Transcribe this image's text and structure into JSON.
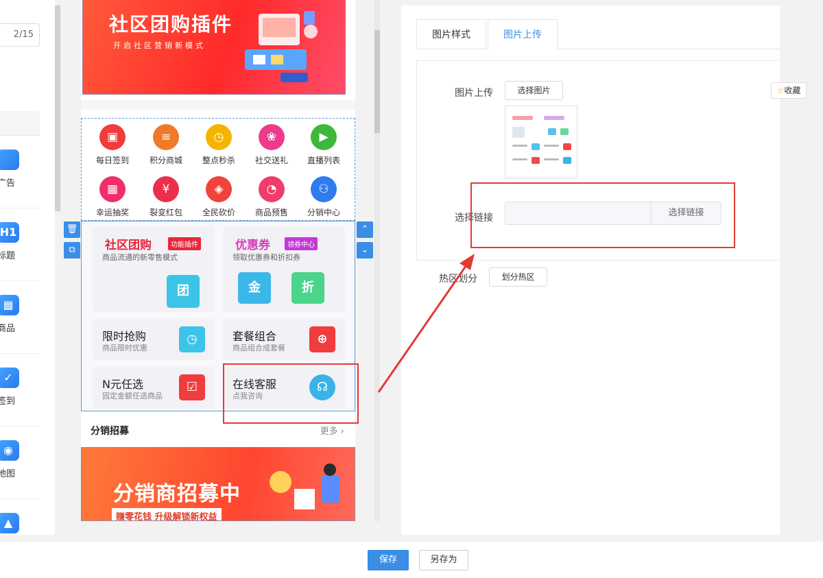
{
  "left_panel": {
    "counter": "2/15",
    "components": [
      {
        "label": "播广告",
        "icon": "ad-banner-icon",
        "glyph": ""
      },
      {
        "label": "标题",
        "icon": "heading-icon",
        "glyph": "H1"
      },
      {
        "label": "商品",
        "icon": "basket-icon",
        "glyph": "▦"
      },
      {
        "label": "签到",
        "icon": "calendar-check-icon",
        "glyph": "✓"
      },
      {
        "label": "地图",
        "icon": "map-pin-icon",
        "glyph": "◉"
      },
      {
        "label": "",
        "icon": "image-icon",
        "glyph": "▲"
      }
    ]
  },
  "preview": {
    "banner": {
      "title": "社区团购插件",
      "subtitle": "开启社区营销新模式"
    },
    "nav": [
      {
        "label": "每日签到",
        "icon": "calendar-icon",
        "glyph": "▣",
        "color": "#f03c3c"
      },
      {
        "label": "积分商城",
        "icon": "coins-icon",
        "glyph": "≡",
        "color": "#f07a2a"
      },
      {
        "label": "整点秒杀",
        "icon": "alarm-clock-icon",
        "glyph": "◷",
        "color": "#f5b400"
      },
      {
        "label": "社交送礼",
        "icon": "gift-icon",
        "glyph": "❀",
        "color": "#ee3a8c"
      },
      {
        "label": "直播列表",
        "icon": "live-tv-icon",
        "glyph": "▶",
        "color": "#3fb73b"
      },
      {
        "label": "幸运抽奖",
        "icon": "grid-icon",
        "glyph": "▦",
        "color": "#ef2f6a"
      },
      {
        "label": "裂变红包",
        "icon": "red-packet-icon",
        "glyph": "¥",
        "color": "#ea2f4d"
      },
      {
        "label": "全民砍价",
        "icon": "tag-icon",
        "glyph": "◈",
        "color": "#f0443a"
      },
      {
        "label": "商品预售",
        "icon": "presale-icon",
        "glyph": "◔",
        "color": "#ef3d6a"
      },
      {
        "label": "分销中心",
        "icon": "network-icon",
        "glyph": "⚇",
        "color": "#2f7bf0"
      }
    ],
    "cards": {
      "group_buy": {
        "title": "社区团购",
        "tag": "功能插件",
        "sub": "商品流通的新零售模式",
        "glyph": "团"
      },
      "coupon": {
        "title": "优惠券",
        "tag": "领券中心",
        "sub": "领取优惠券和折扣券",
        "glyph1": "金",
        "glyph2": "折"
      },
      "flash": {
        "title": "限时抢购",
        "sub": "商品限时优惠"
      },
      "combo": {
        "title": "套餐组合",
        "sub": "商品组合成套餐"
      },
      "nyuan": {
        "title": "N元任选",
        "sub": "固定金额任选商品"
      },
      "service": {
        "title": "在线客服",
        "sub": "点我咨询"
      }
    },
    "distribution": {
      "title": "分销招募",
      "more": "更多",
      "banner_title": "分销商招募中",
      "banner_sub": "赚零花钱  升级解锁新权益"
    }
  },
  "right_panel": {
    "tabs": [
      "图片样式",
      "图片上传"
    ],
    "upload_label": "图片上传",
    "choose_image": "选择图片",
    "link_label": "选择链接",
    "link_value": "",
    "choose_link": "选择链接",
    "hotzone_label": "热区划分",
    "hotzone_button": "划分热区"
  },
  "favorite": "收藏",
  "bottom": {
    "save": "保存",
    "save_as": "另存为"
  },
  "colors": {
    "accent": "#3a8ee6",
    "annotation": "#e53935"
  }
}
